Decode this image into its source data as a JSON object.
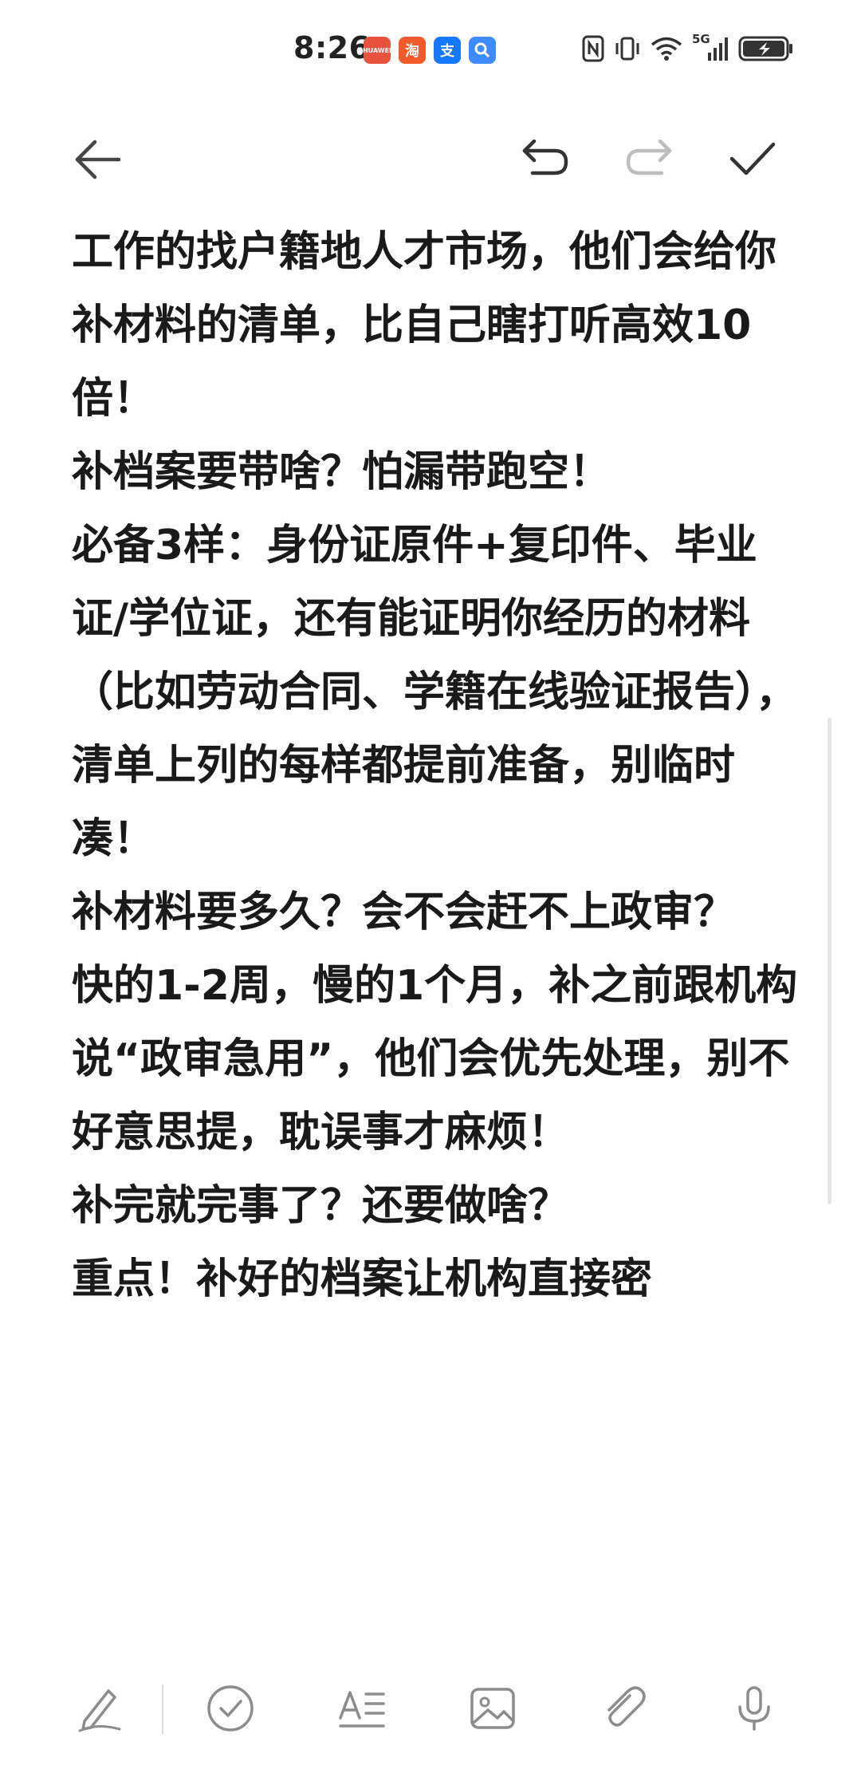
{
  "status_bar": {
    "time": "8:26",
    "app_icons": [
      {
        "name": "huawei-icon",
        "color": "#e8533f",
        "label": "HUAWEI"
      },
      {
        "name": "taobao-icon",
        "color": "#f25a2c",
        "label": "淘"
      },
      {
        "name": "alipay-icon",
        "color": "#1677ff",
        "label": "支"
      },
      {
        "name": "search-app-icon",
        "color": "#3d8bff",
        "label": ""
      }
    ],
    "network": "5G"
  },
  "toolbar": {
    "back": "back-arrow-icon",
    "undo": "undo-icon",
    "redo": "redo-icon",
    "done": "check-icon"
  },
  "note": {
    "paragraphs": [
      "工作的找户籍地人才市场，他们会给你补材料的清单，比自己瞎打听高效10倍！",
      "",
      "补档案要带啥？怕漏带跑空！",
      "必备3样：身份证原件+复印件、毕业证/学位证，还有能证明你经历的材料（比如劳动合同、学籍在线验证报告），清单上列的每样都提前准备，别临时凑！",
      "",
      "补材料要多久？会不会赶不上政审？",
      "快的1-2周，慢的1个月，补之前跟机构说“政审急用”，他们会优先处理，别不好意思提，耽误事才麻烦！",
      "",
      "补完就完事了？还要做啥？",
      "重点！补好的档案让机构直接密"
    ]
  },
  "bottom_bar": {
    "items": [
      "handwriting-icon",
      "checklist-icon",
      "text-format-icon",
      "image-icon",
      "attachment-icon",
      "microphone-icon"
    ]
  },
  "colors": {
    "text": "#1a1a1a",
    "icon": "#444444",
    "disabled_icon": "#bdbdbd",
    "bottom_icon": "#8c8c8c"
  }
}
